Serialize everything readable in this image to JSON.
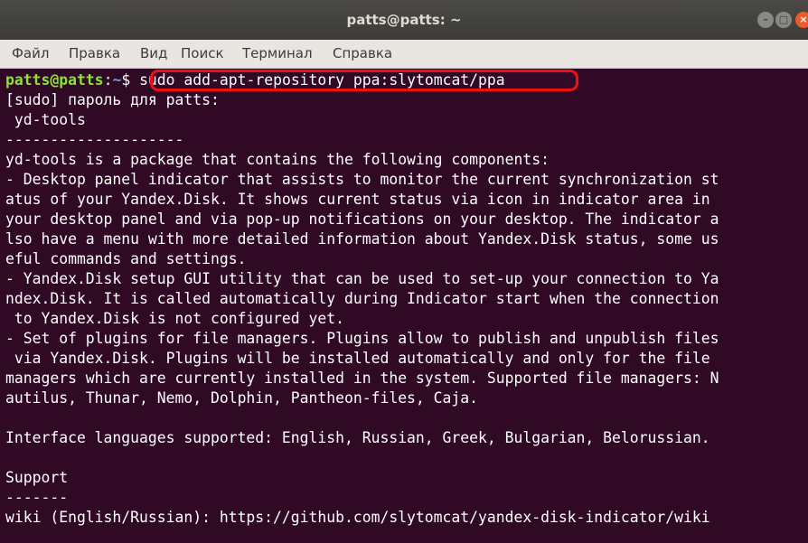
{
  "window": {
    "title": "patts@patts: ~"
  },
  "menu": {
    "items": [
      "Файл",
      "Правка",
      "Вид",
      "Поиск",
      "Терминал",
      "Справка"
    ]
  },
  "terminal": {
    "prompt_user": "patts@patts",
    "prompt_colon": ":",
    "prompt_path": "~",
    "prompt_dollar": "$ ",
    "command": "sudo add-apt-repository ppa:slytomcat/ppa",
    "output_lines": [
      "[sudo] пароль для patts:",
      " yd-tools",
      "--------------------",
      "yd-tools is a package that contains the following components:",
      "- Desktop panel indicator that assists to monitor the current synchronization st",
      "atus of your Yandex.Disk. It shows current status via icon in indicator area in",
      "your desktop panel and via pop-up notifications on your desktop. The indicator a",
      "lso have a menu with more detailed information about Yandex.Disk status, some us",
      "eful commands and settings.",
      "- Yandex.Disk setup GUI utility that can be used to set-up your connection to Ya",
      "ndex.Disk. It is called automatically during Indicator start when the connection",
      " to Yandex.Disk is not configured yet.",
      "- Set of plugins for file managers. Plugins allow to publish and unpublish files",
      " via Yandex.Disk. Plugins will be installed automatically and only for the file",
      "managers which are currently installed in the system. Supported file managers: N",
      "autilus, Thunar, Nemo, Dolphin, Pantheon-files, Caja.",
      "",
      "Interface languages supported: English, Russian, Greek, Bulgarian, Belorussian.",
      "",
      "Support",
      "-------",
      "wiki (English/Russian): https://github.com/slytomcat/yandex-disk-indicator/wiki"
    ]
  },
  "colors": {
    "terminal_bg": "#300a24",
    "prompt_user": "#8ae234",
    "prompt_path": "#729fcf",
    "highlight": "#ee1111",
    "close_button": "#ef5a28"
  }
}
